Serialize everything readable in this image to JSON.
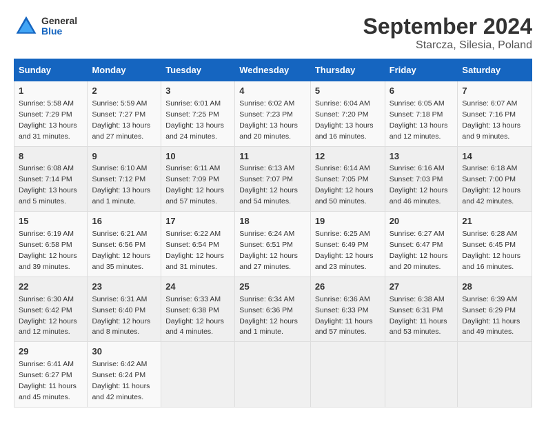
{
  "header": {
    "logo": {
      "general": "General",
      "blue": "Blue"
    },
    "title": "September 2024",
    "subtitle": "Starcza, Silesia, Poland"
  },
  "weekdays": [
    "Sunday",
    "Monday",
    "Tuesday",
    "Wednesday",
    "Thursday",
    "Friday",
    "Saturday"
  ],
  "weeks": [
    [
      {
        "day": "1",
        "info": "Sunrise: 5:58 AM\nSunset: 7:29 PM\nDaylight: 13 hours and 31 minutes."
      },
      {
        "day": "2",
        "info": "Sunrise: 5:59 AM\nSunset: 7:27 PM\nDaylight: 13 hours and 27 minutes."
      },
      {
        "day": "3",
        "info": "Sunrise: 6:01 AM\nSunset: 7:25 PM\nDaylight: 13 hours and 24 minutes."
      },
      {
        "day": "4",
        "info": "Sunrise: 6:02 AM\nSunset: 7:23 PM\nDaylight: 13 hours and 20 minutes."
      },
      {
        "day": "5",
        "info": "Sunrise: 6:04 AM\nSunset: 7:20 PM\nDaylight: 13 hours and 16 minutes."
      },
      {
        "day": "6",
        "info": "Sunrise: 6:05 AM\nSunset: 7:18 PM\nDaylight: 13 hours and 12 minutes."
      },
      {
        "day": "7",
        "info": "Sunrise: 6:07 AM\nSunset: 7:16 PM\nDaylight: 13 hours and 9 minutes."
      }
    ],
    [
      {
        "day": "8",
        "info": "Sunrise: 6:08 AM\nSunset: 7:14 PM\nDaylight: 13 hours and 5 minutes."
      },
      {
        "day": "9",
        "info": "Sunrise: 6:10 AM\nSunset: 7:12 PM\nDaylight: 13 hours and 1 minute."
      },
      {
        "day": "10",
        "info": "Sunrise: 6:11 AM\nSunset: 7:09 PM\nDaylight: 12 hours and 57 minutes."
      },
      {
        "day": "11",
        "info": "Sunrise: 6:13 AM\nSunset: 7:07 PM\nDaylight: 12 hours and 54 minutes."
      },
      {
        "day": "12",
        "info": "Sunrise: 6:14 AM\nSunset: 7:05 PM\nDaylight: 12 hours and 50 minutes."
      },
      {
        "day": "13",
        "info": "Sunrise: 6:16 AM\nSunset: 7:03 PM\nDaylight: 12 hours and 46 minutes."
      },
      {
        "day": "14",
        "info": "Sunrise: 6:18 AM\nSunset: 7:00 PM\nDaylight: 12 hours and 42 minutes."
      }
    ],
    [
      {
        "day": "15",
        "info": "Sunrise: 6:19 AM\nSunset: 6:58 PM\nDaylight: 12 hours and 39 minutes."
      },
      {
        "day": "16",
        "info": "Sunrise: 6:21 AM\nSunset: 6:56 PM\nDaylight: 12 hours and 35 minutes."
      },
      {
        "day": "17",
        "info": "Sunrise: 6:22 AM\nSunset: 6:54 PM\nDaylight: 12 hours and 31 minutes."
      },
      {
        "day": "18",
        "info": "Sunrise: 6:24 AM\nSunset: 6:51 PM\nDaylight: 12 hours and 27 minutes."
      },
      {
        "day": "19",
        "info": "Sunrise: 6:25 AM\nSunset: 6:49 PM\nDaylight: 12 hours and 23 minutes."
      },
      {
        "day": "20",
        "info": "Sunrise: 6:27 AM\nSunset: 6:47 PM\nDaylight: 12 hours and 20 minutes."
      },
      {
        "day": "21",
        "info": "Sunrise: 6:28 AM\nSunset: 6:45 PM\nDaylight: 12 hours and 16 minutes."
      }
    ],
    [
      {
        "day": "22",
        "info": "Sunrise: 6:30 AM\nSunset: 6:42 PM\nDaylight: 12 hours and 12 minutes."
      },
      {
        "day": "23",
        "info": "Sunrise: 6:31 AM\nSunset: 6:40 PM\nDaylight: 12 hours and 8 minutes."
      },
      {
        "day": "24",
        "info": "Sunrise: 6:33 AM\nSunset: 6:38 PM\nDaylight: 12 hours and 4 minutes."
      },
      {
        "day": "25",
        "info": "Sunrise: 6:34 AM\nSunset: 6:36 PM\nDaylight: 12 hours and 1 minute."
      },
      {
        "day": "26",
        "info": "Sunrise: 6:36 AM\nSunset: 6:33 PM\nDaylight: 11 hours and 57 minutes."
      },
      {
        "day": "27",
        "info": "Sunrise: 6:38 AM\nSunset: 6:31 PM\nDaylight: 11 hours and 53 minutes."
      },
      {
        "day": "28",
        "info": "Sunrise: 6:39 AM\nSunset: 6:29 PM\nDaylight: 11 hours and 49 minutes."
      }
    ],
    [
      {
        "day": "29",
        "info": "Sunrise: 6:41 AM\nSunset: 6:27 PM\nDaylight: 11 hours and 45 minutes."
      },
      {
        "day": "30",
        "info": "Sunrise: 6:42 AM\nSunset: 6:24 PM\nDaylight: 11 hours and 42 minutes."
      },
      {
        "day": "",
        "info": ""
      },
      {
        "day": "",
        "info": ""
      },
      {
        "day": "",
        "info": ""
      },
      {
        "day": "",
        "info": ""
      },
      {
        "day": "",
        "info": ""
      }
    ]
  ]
}
